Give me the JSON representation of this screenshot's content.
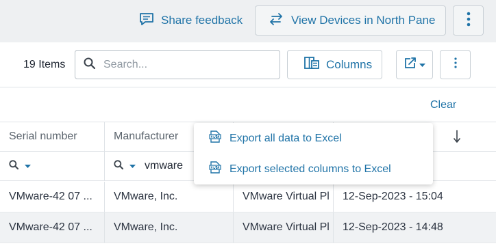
{
  "topbar": {
    "share_feedback": "Share feedback",
    "view_devices": "View Devices in North Pane"
  },
  "toolbar": {
    "items_count": "19 Items",
    "search_placeholder": "Search...",
    "columns_label": "Columns"
  },
  "subbar": {
    "clear_label": "Clear"
  },
  "export_menu": {
    "items": [
      {
        "label": "Export all data to Excel",
        "icon": "excel-icon"
      },
      {
        "label": "Export selected columns to Excel",
        "icon": "excel-icon"
      }
    ]
  },
  "grid": {
    "columns": [
      "Serial number",
      "Manufacturer",
      "",
      ""
    ],
    "filters": [
      "",
      "vmware",
      "",
      ""
    ],
    "rows": [
      [
        "VMware-42 07 ...",
        "VMware, Inc.",
        "VMware Virtual Pl",
        "12-Sep-2023 - 15:04"
      ],
      [
        "VMware-42 07 ...",
        "VMware, Inc.",
        "VMware Virtual Pl",
        "12-Sep-2023 - 14:48"
      ]
    ]
  },
  "colors": {
    "accent": "#1f73a7",
    "border": "#c9d0d6",
    "background": "#eef0f2"
  }
}
